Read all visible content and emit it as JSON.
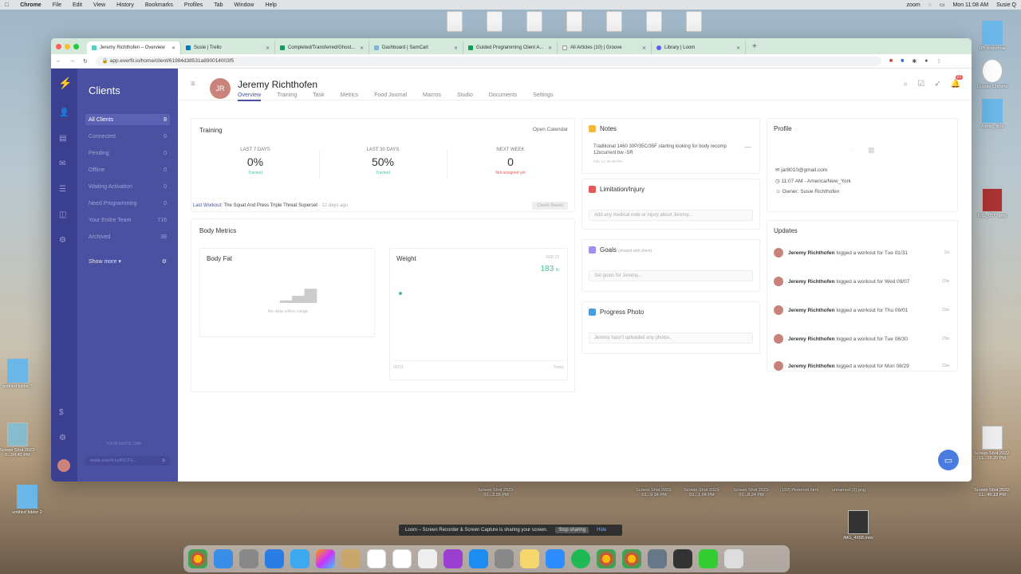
{
  "menubar": {
    "apple": "",
    "items": [
      "Chrome",
      "File",
      "Edit",
      "View",
      "History",
      "Bookmarks",
      "Profiles",
      "Tab",
      "Window",
      "Help"
    ],
    "right": {
      "zoom": "zoom",
      "clock": "Mon 11:08 AM",
      "user": "Susie Q"
    }
  },
  "browser": {
    "tabs": [
      {
        "label": "Jeremy Richthofen – Overview",
        "active": true
      },
      {
        "label": "Susie | Trello"
      },
      {
        "label": "Completed/Transferred/Ghost..."
      },
      {
        "label": "Dashboard | SamCart"
      },
      {
        "label": "Guided Programming Client A..."
      },
      {
        "label": "All Articles (10) | Groove"
      },
      {
        "label": "Library | Loom"
      }
    ],
    "new_tab": "+",
    "url": "app.everfit.io/home/client/61984d38531a890014003f5"
  },
  "sidebar": {
    "title": "Clients",
    "items": [
      {
        "label": "All Clients",
        "count": "8",
        "selected": true
      },
      {
        "label": "Connected",
        "count": "0"
      },
      {
        "label": "Pending",
        "count": "0"
      },
      {
        "label": "Offline",
        "count": "0"
      },
      {
        "label": "Waiting Activation",
        "count": "0"
      },
      {
        "label": "Need Programming",
        "count": "0"
      },
      {
        "label": "Your Entire Team",
        "count": "716"
      },
      {
        "label": "Archived",
        "count": "38"
      }
    ],
    "show_more": "Show more",
    "invite_label": "YOUR INVITE LINK",
    "invite_link": "invite.everfit.io/45CF9..."
  },
  "client": {
    "initials": "JR",
    "name": "Jeremy Richthofen",
    "tabs": [
      "Overview",
      "Training",
      "Task",
      "Metrics",
      "Food Journal",
      "Macros",
      "Studio",
      "Documents",
      "Settings"
    ],
    "notif_count": "21"
  },
  "training": {
    "title": "Training",
    "open_calendar": "Open Calendar",
    "stats": [
      {
        "label": "LAST 7 DAYS",
        "value": "0%",
        "sub": "Tracked",
        "sub_color": "#4cc38a"
      },
      {
        "label": "LAST 30 DAYS",
        "value": "50%",
        "sub": "Tracked",
        "sub_color": "#4cc38a"
      },
      {
        "label": "NEXT WEEK",
        "value": "0",
        "sub": "Not assigned yet",
        "sub_color": "#e05a5a"
      }
    ],
    "last_workout_label": "Last Workout:",
    "last_workout_name": "The Squat And Press Triple Threat Superset",
    "last_workout_ago": "- 12 days ago",
    "check_result": "Check Result"
  },
  "body_metrics": {
    "title": "Body Metrics",
    "body_fat": {
      "title": "Body Fat",
      "empty": "No data within range"
    },
    "weight": {
      "title": "Weight",
      "date": "FEB 15",
      "value": "183",
      "unit": "lb",
      "start": "02/13",
      "end": "Today"
    }
  },
  "notes": {
    "title": "Notes",
    "text": "Traditional 1460 30P/35C/35F starting looking for body recomp 12xcurrent bw -SR",
    "date": "Feb 14, 05:38 PM"
  },
  "limitation": {
    "title": "Limitation/Injury",
    "placeholder": "Add any medical note or injury about Jeremy..."
  },
  "goals": {
    "title": "Goals",
    "shared": "(shared with client)",
    "placeholder": "Set goals for Jeremy..."
  },
  "progress": {
    "title": "Progress Photo",
    "empty": "Jeremy hasn't uploaded any photos."
  },
  "profile": {
    "title": "Profile",
    "email": "jar8010@gmail.com",
    "time": "11:07 AM - America/New_York",
    "owner": "Owner: Susie Richthofen"
  },
  "updates": {
    "title": "Updates",
    "items": [
      {
        "name": "Jeremy Richthofen",
        "action": "logged a workout for Tue 01/31",
        "time": "1w"
      },
      {
        "name": "Jeremy Richthofen",
        "action": "logged a workout for Wed 09/07",
        "time": "22w"
      },
      {
        "name": "Jeremy Richthofen",
        "action": "logged a workout for Thu 09/01",
        "time": "23w"
      },
      {
        "name": "Jeremy Richthofen",
        "action": "logged a workout for Tue 08/30",
        "time": "23w"
      },
      {
        "name": "Jeremy Richthofen",
        "action": "logged a workout for Mon 08/29",
        "time": "23w"
      }
    ]
  },
  "loom": {
    "text": "Loom – Screen Recorder & Screen Capture is sharing your screen.",
    "stop": "Stop sharing",
    "hide": "Hide"
  },
  "desktop_files": [
    {
      "label": "Screen Shot 2023-0...04.42 PM"
    },
    {
      "label": "untitled folder 3"
    },
    {
      "label": "untitled folder 2"
    },
    {
      "label": "Screen Shot 2023-01...3.55 PM"
    },
    {
      "label": "Screen Shot 2023-01...9.34 PM"
    },
    {
      "label": "Screen Shot 2023-01...1.04 PM"
    },
    {
      "label": "Screen Shot 2023-01...8.24 PM"
    },
    {
      "label": "(192) Pinterest.html"
    },
    {
      "label": "unnamed (2).png"
    },
    {
      "label": "Screen Shot 2022-11...45.18 PM"
    },
    {
      "label": "DB slideshow"
    },
    {
      "label": "Google Chrome"
    },
    {
      "label": "Admin_files"
    },
    {
      "label": "IMG_0577.png"
    },
    {
      "label": "IMG_4658.mov"
    },
    {
      "label": "Screen Shot 2022-11...18.20 PM"
    }
  ],
  "colors": {
    "rail": "#3a3f8f",
    "sidebar": "#4a51a0",
    "accent": "#4a51a0",
    "green": "#4cc38a",
    "red": "#e05a5a"
  }
}
